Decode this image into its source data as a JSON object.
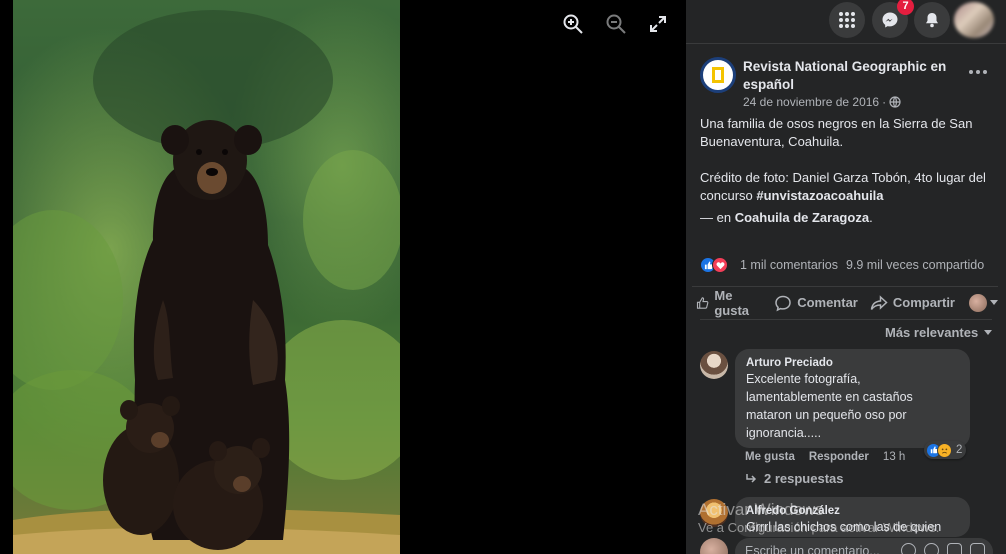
{
  "viewer": {
    "tools": [
      {
        "name": "zoom-in-icon"
      },
      {
        "name": "zoom-out-icon"
      },
      {
        "name": "fullscreen-icon"
      }
    ]
  },
  "topbar": {
    "menu_icon": "grid-menu-icon",
    "messenger_icon": "messenger-icon",
    "messenger_badge": "7",
    "notifications_icon": "bell-icon"
  },
  "post": {
    "page_name": "Revista National Geographic en español",
    "date": "24 de noviembre de 2016",
    "separator": "·",
    "audience_icon": "globe-icon",
    "line1": "Una familia de osos negros en la Sierra de San Buenaventura, Coahuila.",
    "credit_prefix": "Crédito de foto: Daniel Garza Tobón, 4to lugar del concurso ",
    "hashtag": "#unvistazoacoahuila",
    "location_prefix": "— en ",
    "location": "Coahuila de Zaragoza",
    "location_suffix": "."
  },
  "stats": {
    "comments": "1 mil comentarios",
    "shares": "9.9 mil veces compartido"
  },
  "actions": {
    "like": "Me gusta",
    "comment": "Comentar",
    "share": "Compartir"
  },
  "sort_label": "Más relevantes",
  "comments": [
    {
      "author": "Arturo Preciado",
      "text": "Excelente fotografía, lamentablemente en castaños mataron un pequeño oso por ignorancia.....",
      "reaction_count": "2",
      "like": "Me gusta",
      "reply": "Responder",
      "time": "13 h",
      "replies": "2 respuestas"
    },
    {
      "author": "Alfredo González",
      "text": "Grrrl las chichos como las de quien"
    }
  ],
  "composer": {
    "placeholder": "Escribe un comentario..."
  },
  "watermark": {
    "title": "Activar Windows",
    "subtitle": "Ve a Configuración para activar Windows."
  },
  "colors": {
    "panel_bg": "#242526",
    "bubble_bg": "#3a3b3c",
    "text_primary": "#e4e6eb",
    "text_secondary": "#b0b3b8",
    "like_blue": "#1b74e4",
    "badge_red": "#e41e3f"
  }
}
